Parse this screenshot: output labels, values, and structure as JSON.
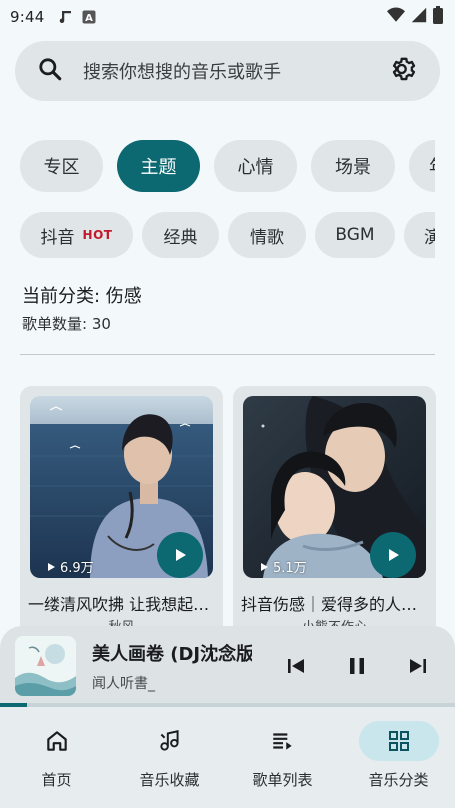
{
  "status": {
    "time": "9:44",
    "music_icon": "music-note-icon",
    "a_icon": "a-badge-icon",
    "wifi_icon": "wifi-icon",
    "signal_icon": "signal-icon",
    "battery_icon": "battery-icon"
  },
  "search": {
    "placeholder": "搜索你想搜的音乐或歌手",
    "search_icon": "search-icon",
    "settings_icon": "gear-icon"
  },
  "primary_tabs": [
    {
      "label": "专区",
      "active": false
    },
    {
      "label": "主题",
      "active": true
    },
    {
      "label": "心情",
      "active": false
    },
    {
      "label": "场景",
      "active": false
    },
    {
      "label": "年",
      "active": false
    }
  ],
  "secondary_tabs": [
    {
      "label": "抖音",
      "badge": "HOT"
    },
    {
      "label": "经典"
    },
    {
      "label": "情歌"
    },
    {
      "label": "BGM"
    },
    {
      "label": "演"
    }
  ],
  "category": {
    "title": "当前分类: 伤感",
    "count": "歌单数量: 30"
  },
  "playlists": [
    {
      "plays": "6.9万",
      "name": "一缕清风吹拂 让我想起了你",
      "author": "秋风"
    },
    {
      "plays": "5.1万",
      "name": "抖音伤感｜爱得多的人输得一塌糊涂",
      "author": "小熊不作心"
    }
  ],
  "player": {
    "title": "美人画卷 (DJ沈念版)",
    "artist": "闻人听書_",
    "progress": 0.06
  },
  "nav": [
    {
      "label": "首页",
      "icon": "home-icon",
      "active": false
    },
    {
      "label": "音乐收藏",
      "icon": "music-collection-icon",
      "active": false
    },
    {
      "label": "歌单列表",
      "icon": "playlist-icon",
      "active": false
    },
    {
      "label": "音乐分类",
      "icon": "category-grid-icon",
      "active": true
    }
  ],
  "colors": {
    "accent": "#0c6871",
    "background": "#f3f9fa",
    "surface": "#e0e6e8",
    "hot": "#c2182b"
  }
}
